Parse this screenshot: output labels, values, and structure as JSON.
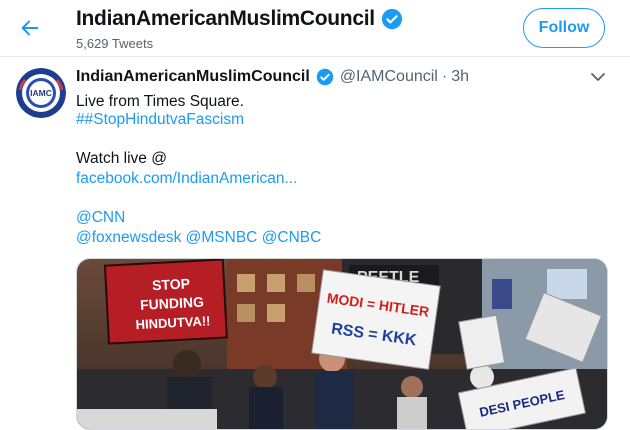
{
  "header": {
    "back_label": "Back",
    "title": "IndianAmericanMuslimCouncil",
    "subtitle": "5,629 Tweets",
    "follow_label": "Follow"
  },
  "tweet": {
    "display_name": "IndianAmericanMuslimCouncil",
    "handle": "@IAMCouncil",
    "separator": "·",
    "time": "3h",
    "line1": "Live from Times Square.",
    "hashtag": "##StopHindutvaFascism",
    "line_watch": "Watch live @",
    "link_facebook": "facebook.com/IndianAmerican...",
    "mention_cnn": "@CNN",
    "mention_fox": "@foxnewsdesk",
    "mention_msnbc": "@MSNBC",
    "mention_cnbc": "@CNBC"
  },
  "avatar": {
    "text": "IAMC",
    "ring_top": "PEACE · JUSTICE",
    "ring_bottom": "PLURALISM"
  },
  "media": {
    "sign1_line1": "STOP",
    "sign1_line2": "FUNDING",
    "sign1_line3": "HINDUTVA!!",
    "sign2_line1": "MODI = HITLER",
    "sign2_line2": "RSS = KKK",
    "sign3_line1": "DESI PEOPLE",
    "store_sign": "PEETLE"
  },
  "colors": {
    "accent": "#1d9bf0",
    "text": "#0f1419",
    "muted": "#536471"
  }
}
